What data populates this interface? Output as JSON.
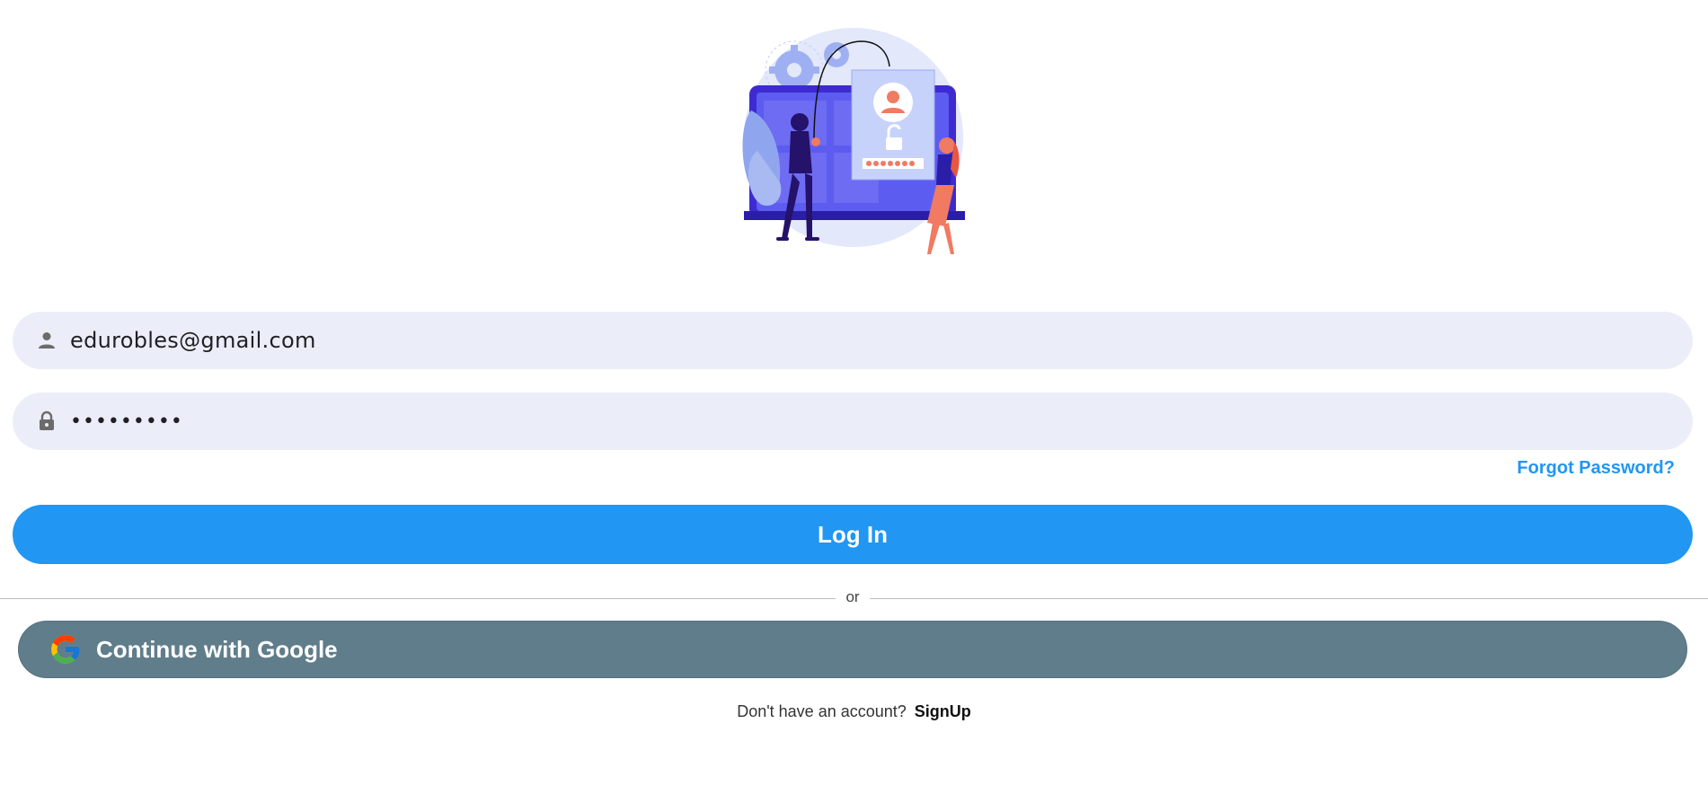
{
  "login": {
    "email_value": "edurobles@gmail.com",
    "password_value": "•••••••••",
    "forgot_label": "Forgot Password?",
    "login_label": "Log In",
    "divider_text": "or",
    "google_label": "Continue with Google",
    "signup_prompt": "Don't have an account?",
    "signup_label": "SignUp"
  },
  "icons": {
    "email_field": "person-icon",
    "password_field": "lock-icon",
    "google_button": "google-g-icon"
  },
  "colors": {
    "primary": "#2196f3",
    "google_button": "#607d8b",
    "field_background": "#ebeef8",
    "hero_accent": "#5c5cf0",
    "hero_person_accent": "#f07a62"
  }
}
